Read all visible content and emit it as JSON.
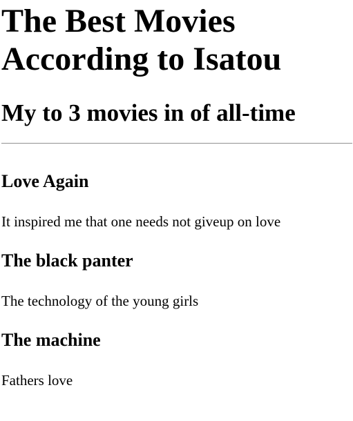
{
  "page": {
    "title": "The Best Movies According to Isatou",
    "subtitle": "My to 3 movies in of all-time"
  },
  "movies": [
    {
      "title": "Love Again",
      "description": "It inspired me that one needs not giveup on love"
    },
    {
      "title": "The black panter",
      "description": "The technology of the young girls"
    },
    {
      "title": "The machine",
      "description": "Fathers love"
    }
  ]
}
